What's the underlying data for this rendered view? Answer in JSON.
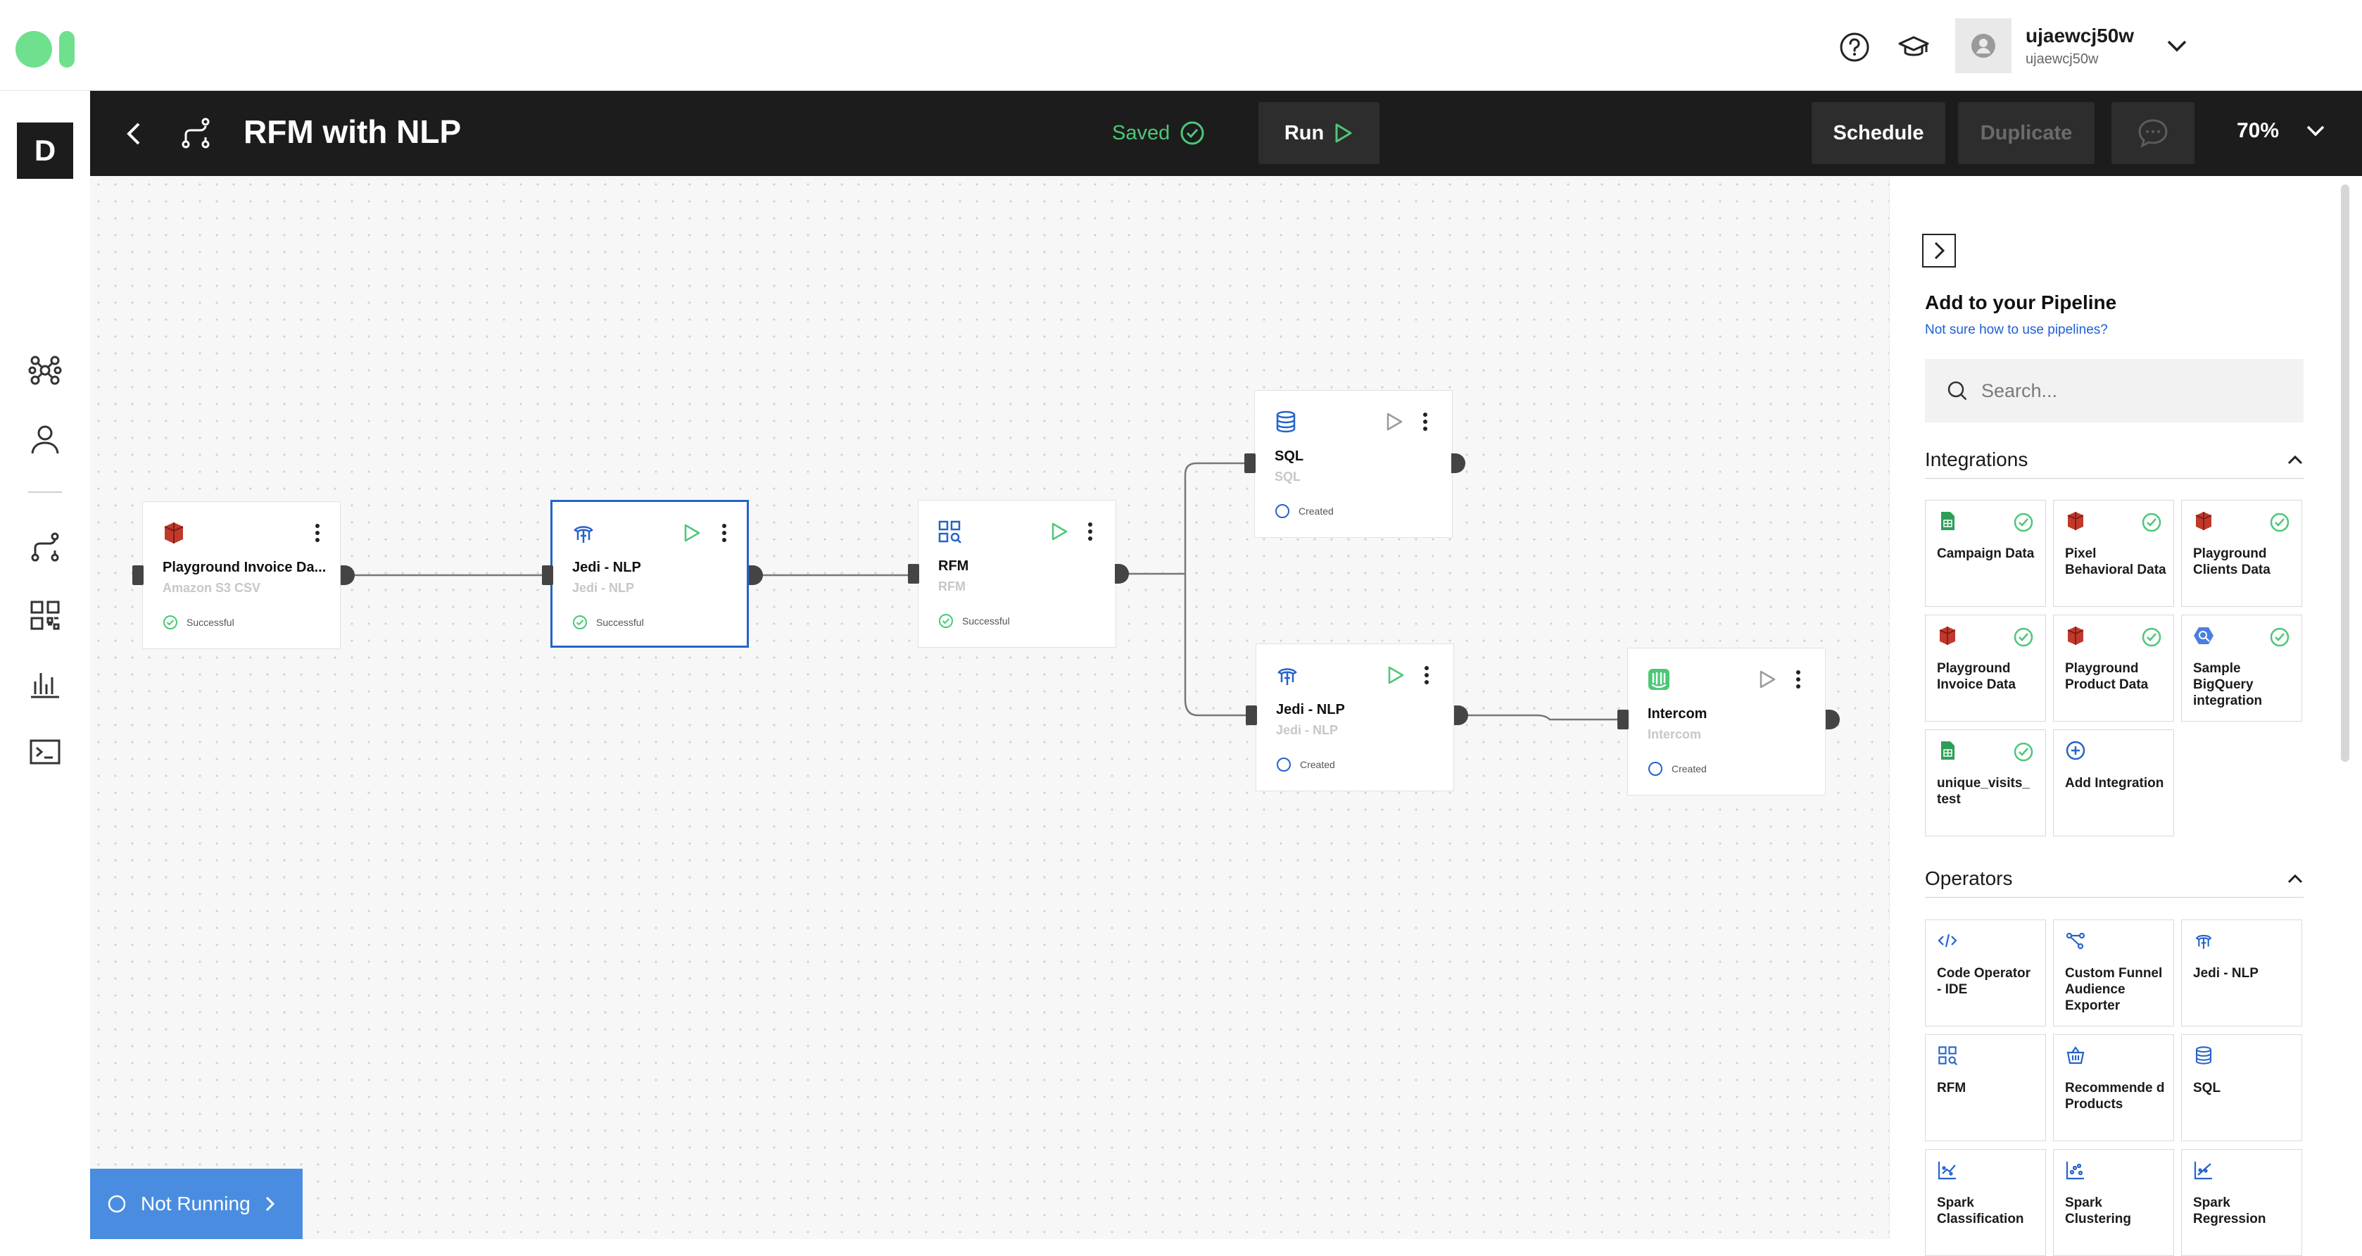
{
  "app": {
    "user_name": "ujaewcj50w",
    "user_sub": "ujaewcj50w",
    "workspace_letter": "D"
  },
  "header": {
    "title": "RFM with NLP",
    "saved_label": "Saved",
    "run_label": "Run",
    "schedule_label": "Schedule",
    "duplicate_label": "Duplicate",
    "zoom": "70%"
  },
  "canvas": {
    "nodes": [
      {
        "title": "Playground Invoice Da...",
        "subtitle": "Amazon S3 CSV",
        "status": "Successful",
        "icon": "aws-s3-icon"
      },
      {
        "title": "Jedi - NLP",
        "subtitle": "Jedi - NLP",
        "status": "Successful",
        "icon": "jedi-icon",
        "selected": true
      },
      {
        "title": "RFM",
        "subtitle": "RFM",
        "status": "Successful",
        "icon": "rfm-icon"
      },
      {
        "title": "SQL",
        "subtitle": "SQL",
        "status": "Created",
        "icon": "database-icon"
      },
      {
        "title": "Jedi - NLP",
        "subtitle": "Jedi - NLP",
        "status": "Created",
        "icon": "jedi-icon"
      },
      {
        "title": "Intercom",
        "subtitle": "Intercom",
        "status": "Created",
        "icon": "intercom-icon"
      }
    ],
    "run_status": "Not Running"
  },
  "panel": {
    "title": "Add to your Pipeline",
    "help_link": "Not sure how to use pipelines?",
    "search_placeholder": "Search...",
    "integrations_title": "Integrations",
    "integrations": [
      {
        "label": "Campaign Data",
        "icon": "google-sheets-icon",
        "check": true
      },
      {
        "label": "Pixel Behavioral Data",
        "icon": "aws-s3-icon",
        "check": true
      },
      {
        "label": "Playground Clients Data",
        "icon": "aws-s3-icon",
        "check": true
      },
      {
        "label": "Playground Invoice Data",
        "icon": "aws-s3-icon",
        "check": true
      },
      {
        "label": "Playground Product Data",
        "icon": "aws-s3-icon",
        "check": true
      },
      {
        "label": "Sample BigQuery integration",
        "icon": "bigquery-icon",
        "check": true
      },
      {
        "label": "unique_visits_ test",
        "icon": "google-sheets-icon",
        "check": true
      },
      {
        "label": "Add Integration",
        "icon": "add-icon",
        "check": false
      }
    ],
    "operators_title": "Operators",
    "operators": [
      {
        "label": "Code Operator - IDE",
        "icon": "code-icon"
      },
      {
        "label": "Custom Funnel Audience Exporter",
        "icon": "funnel-icon"
      },
      {
        "label": "Jedi - NLP",
        "icon": "jedi-icon"
      },
      {
        "label": "RFM",
        "icon": "rfm-icon"
      },
      {
        "label": "Recommende d Products",
        "icon": "basket-icon"
      },
      {
        "label": "SQL",
        "icon": "database-icon"
      },
      {
        "label": "Spark Classification",
        "icon": "scatter-icon"
      },
      {
        "label": "Spark Clustering",
        "icon": "scatter-icon"
      },
      {
        "label": "Spark Regression",
        "icon": "scatter-icon"
      }
    ]
  },
  "colors": {
    "accent_green": "#4cc778",
    "accent_blue": "#2563c8",
    "s3_red": "#c0392b",
    "header_bg": "#1c1c1c"
  }
}
